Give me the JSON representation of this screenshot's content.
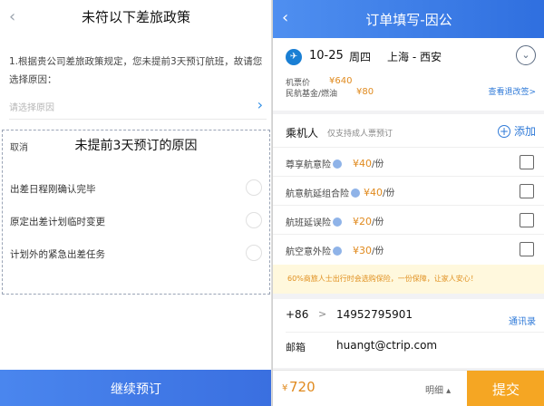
{
  "left": {
    "back_icon": "‹",
    "title": "未符以下差旅政策",
    "note": "1.根据贵公司差旅政策规定，您未提前3天预订航班，故请您选择原因：",
    "select_placeholder": "请选择原因",
    "select_chevron": "›",
    "dialog": {
      "cancel": "取消",
      "title": "未提前3天预订的原因",
      "reasons": [
        {
          "label": "出差日程刚确认完毕"
        },
        {
          "label": "原定出差计划临时变更"
        },
        {
          "label": "计划外的紧急出差任务"
        }
      ]
    },
    "footer_button": "继续预订"
  },
  "right": {
    "back_icon": "‹",
    "title": "订单填写-因公",
    "flight": {
      "airline_icon": "✈",
      "date": "10-25",
      "weekday": "周四",
      "route": "上海 - 西安",
      "expand_icon": "⌄",
      "fare_label": "机票价",
      "fare_value": "¥640",
      "fuel_label": "民航基金/燃油",
      "fuel_value": "¥80",
      "rules_link": "查看退改签>"
    },
    "passengers": {
      "label": "乘机人",
      "hint": "仅支持成人票预订",
      "add_label": "添加",
      "add_icon": "+"
    },
    "insurance": [
      {
        "name": "尊享航意险",
        "price": "¥40",
        "unit": "/份"
      },
      {
        "name": "航意航延组合险",
        "price": "¥40",
        "unit": "/份"
      },
      {
        "name": "航班延误险",
        "price": "¥20",
        "unit": "/份"
      },
      {
        "name": "航空意外险",
        "price": "¥30",
        "unit": "/份"
      }
    ],
    "notice": "60%商旅人士出行时会选购保险，一份保障，让家人安心！",
    "contact": {
      "country_code": "+86",
      "cc_chevron": ">",
      "phone": "14952795901",
      "address_book": "通讯录",
      "email_label": "邮箱",
      "email": "huangt@ctrip.com"
    },
    "bottom": {
      "currency": "¥",
      "total": "720",
      "detail": "明细 ▴",
      "submit": "提交"
    }
  },
  "colors": {
    "primary_blue": "#3a6fe0",
    "accent_orange": "#f5a623",
    "price_orange": "#e08a1e",
    "link_blue": "#2f7ad8"
  }
}
